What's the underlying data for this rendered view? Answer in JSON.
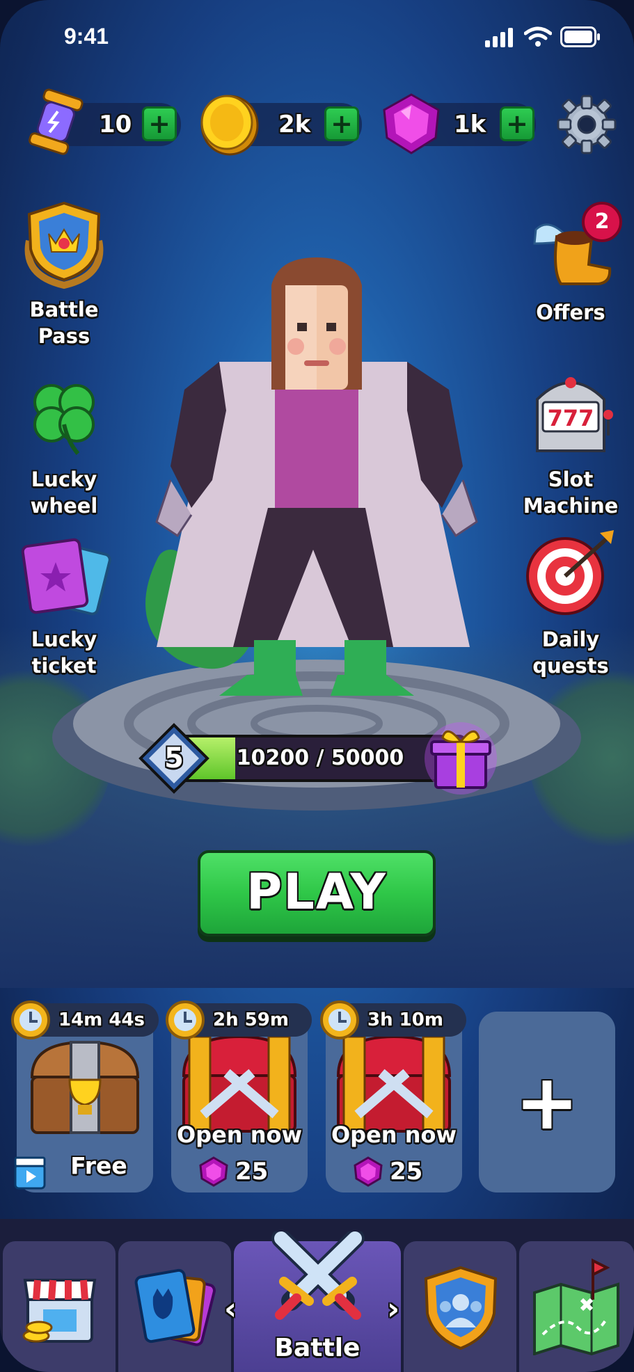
{
  "status_bar": {
    "time": "9:41"
  },
  "currencies": [
    {
      "name": "energy",
      "icon": "hourglass-icon",
      "value": "10"
    },
    {
      "name": "coins",
      "icon": "coin-icon",
      "value": "2k"
    },
    {
      "name": "gems",
      "icon": "gem-icon",
      "value": "1k"
    }
  ],
  "settings_icon": "gear-icon",
  "left_menu": [
    {
      "label": "Battle Pass",
      "icon": "battle-pass-shield-icon"
    },
    {
      "label": "Lucky wheel",
      "icon": "four-leaf-clover-icon"
    },
    {
      "label": "Lucky ticket",
      "icon": "ticket-icon"
    }
  ],
  "right_menu": [
    {
      "label": "Offers",
      "icon": "winged-boot-icon",
      "badge": "2"
    },
    {
      "label": "Slot Machine",
      "icon": "slot-machine-icon",
      "reel": "777"
    },
    {
      "label": "Daily quests",
      "icon": "target-icon"
    }
  ],
  "level": {
    "number": "5",
    "progress_text": "10200 / 50000",
    "progress": 0.204
  },
  "play_button": "PLAY",
  "chests": [
    {
      "timer": "14m 44s",
      "label": "Free",
      "type": "trophy-chest"
    },
    {
      "timer": "2h 59m",
      "label": "Open now",
      "price": "25",
      "type": "battle-chest"
    },
    {
      "timer": "3h 10m",
      "label": "Open now",
      "price": "25",
      "type": "battle-chest"
    }
  ],
  "add_slot": "+",
  "nav": [
    {
      "name": "shop",
      "icon": "shop-icon"
    },
    {
      "name": "cards",
      "icon": "cards-icon"
    },
    {
      "name": "battle",
      "label": "Battle",
      "icon": "crossed-swords-icon",
      "active": true
    },
    {
      "name": "clan",
      "icon": "clan-shield-icon"
    },
    {
      "name": "map",
      "icon": "map-icon"
    }
  ],
  "nav_arrows": {
    "left": "‹",
    "right": "›"
  },
  "colors": {
    "accent_green": "#2fc748",
    "gem": "#e23bd4",
    "coin": "#f4c21c",
    "badge_red": "#d8124a"
  }
}
